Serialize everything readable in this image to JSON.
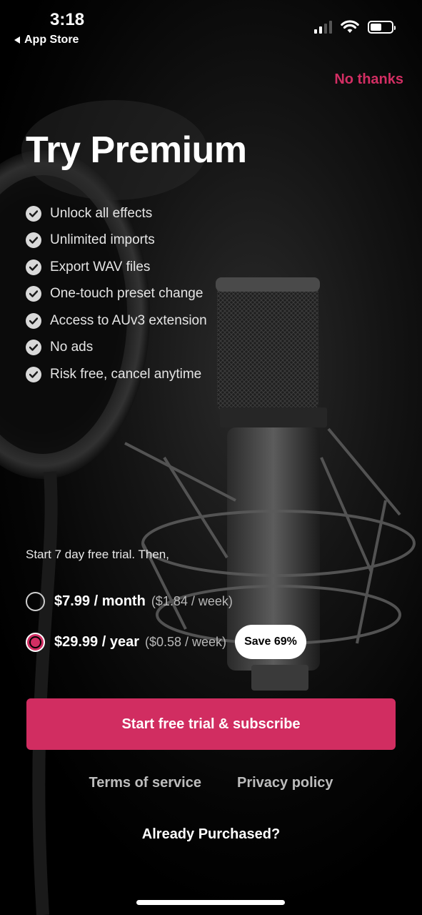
{
  "status_bar": {
    "time": "3:18",
    "back_label": "App Store"
  },
  "header": {
    "dismiss_label": "No thanks"
  },
  "title": "Try Premium",
  "features": [
    "Unlock all effects",
    "Unlimited imports",
    "Export WAV files",
    "One-touch preset change",
    "Access to AUv3 extension",
    "No ads",
    "Risk free, cancel anytime"
  ],
  "plans": {
    "intro": "Start 7 day free trial. Then,",
    "monthly": {
      "price": "$7.99 / month",
      "per_week": "($1.84 / week)",
      "selected": false
    },
    "yearly": {
      "price": "$29.99 / year",
      "per_week": "($0.58 / week)",
      "badge": "Save 69%",
      "selected": true
    }
  },
  "cta_label": "Start free trial & subscribe",
  "footer": {
    "terms_label": "Terms of service",
    "privacy_label": "Privacy policy",
    "restore_label": "Already Purchased?"
  },
  "colors": {
    "accent": "#d22e63",
    "background": "#000000"
  },
  "icons": {
    "feature_check": "check-circle-icon",
    "wifi": "wifi-icon",
    "battery": "battery-icon",
    "signal": "cellular-signal-icon"
  }
}
